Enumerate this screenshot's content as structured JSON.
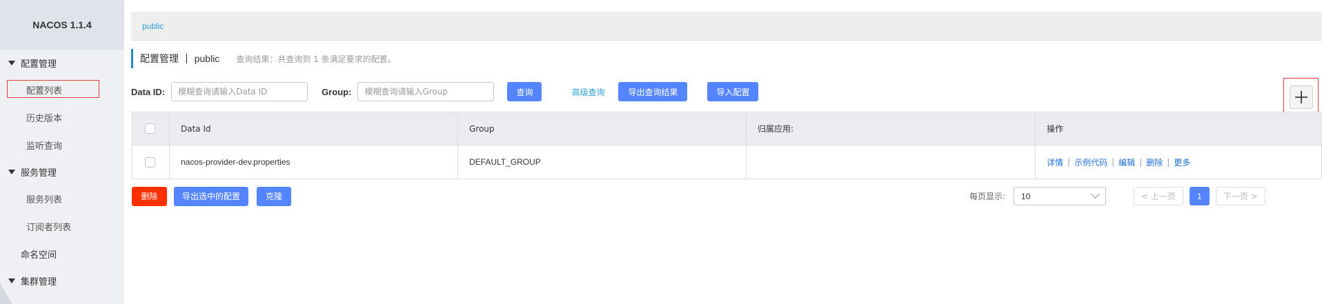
{
  "sidebar": {
    "brand": "NACOS 1.1.4",
    "groups": [
      {
        "label": "配置管理",
        "items": [
          "配置列表",
          "历史版本",
          "监听查询"
        ]
      },
      {
        "label": "服务管理",
        "items": [
          "服务列表",
          "订阅者列表"
        ]
      }
    ],
    "namespace_item": "命名空间",
    "cluster_group": "集群管理"
  },
  "namespace_bar": {
    "current": "public"
  },
  "title": {
    "main": "配置管理",
    "separator": "|",
    "namespace": "public",
    "hint": "查询结果：共查询到 1 条满足要求的配置。"
  },
  "filters": {
    "data_id_label": "Data ID:",
    "data_id_placeholder": "模糊查询请输入Data ID",
    "group_label": "Group:",
    "group_placeholder": "模糊查询请输入Group",
    "query_button": "查询",
    "advanced_link": "高级查询",
    "export_results_button": "导出查询结果",
    "import_button": "导入配置",
    "add_icon": "plus-icon"
  },
  "table": {
    "columns": [
      "Data Id",
      "Group",
      "归属应用:",
      "操作"
    ],
    "rows": [
      {
        "data_id": "nacos-provider-dev.properties",
        "group": "DEFAULT_GROUP",
        "app": "",
        "ops": [
          "详情",
          "示例代码",
          "编辑",
          "删除",
          "更多"
        ]
      }
    ]
  },
  "actions": {
    "delete_button": "删除",
    "export_selected_button": "导出选中的配置",
    "clone_button": "克隆"
  },
  "pagination": {
    "per_page_label": "每页显示:",
    "per_page_value": "10",
    "prev": "< 上一页",
    "current_page": "1",
    "next": "下一页 >"
  },
  "colors": {
    "primary": "#5584ff",
    "danger": "#ff3000",
    "link": "#2fa0d8",
    "highlight_box": "#e23a3a"
  }
}
